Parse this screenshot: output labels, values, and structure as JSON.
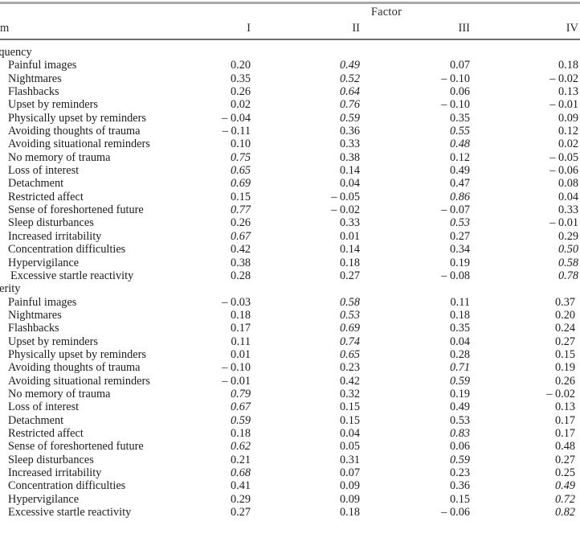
{
  "table": {
    "header": {
      "group_label": "Factor",
      "item_column_label": "m",
      "factor_columns": [
        "I",
        "II",
        "III",
        "IV"
      ]
    },
    "sections": [
      {
        "label": "equency",
        "rows": [
          {
            "item": "Painful images",
            "values": [
              "0.20",
              "0.49",
              "0.07",
              "0.18"
            ],
            "italic": [
              false,
              true,
              false,
              false
            ]
          },
          {
            "item": "Nightmares",
            "values": [
              "0.35",
              "0.52",
              "– 0.10",
              "– 0.02"
            ],
            "italic": [
              false,
              true,
              false,
              false
            ]
          },
          {
            "item": "Flashbacks",
            "values": [
              "0.26",
              "0.64",
              "0.06",
              "0.13"
            ],
            "italic": [
              false,
              true,
              false,
              false
            ]
          },
          {
            "item": "Upset by reminders",
            "values": [
              "0.02",
              "0.76",
              "– 0.10",
              "– 0.01"
            ],
            "italic": [
              false,
              true,
              false,
              false
            ]
          },
          {
            "item": "Physically upset by reminders",
            "values": [
              "– 0.04",
              "0.59",
              "0.35",
              "0.09"
            ],
            "italic": [
              false,
              true,
              false,
              false
            ]
          },
          {
            "item": "Avoiding thoughts of trauma",
            "values": [
              "– 0.11",
              "0.36",
              "0.55",
              "0.12"
            ],
            "italic": [
              false,
              false,
              true,
              false
            ]
          },
          {
            "item": "Avoiding situational reminders",
            "values": [
              "0.10",
              "0.33",
              "0.48",
              "0.02"
            ],
            "italic": [
              false,
              false,
              true,
              false
            ]
          },
          {
            "item": "No memory of trauma",
            "values": [
              "0.75",
              "0.38",
              "0.12",
              "– 0.05"
            ],
            "italic": [
              true,
              false,
              false,
              false
            ]
          },
          {
            "item": "Loss of interest",
            "values": [
              "0.65",
              "0.14",
              "0.49",
              "– 0.06"
            ],
            "italic": [
              true,
              false,
              false,
              false
            ]
          },
          {
            "item": "Detachment",
            "values": [
              "0.69",
              "0.04",
              "0.47",
              "0.08"
            ],
            "italic": [
              true,
              false,
              false,
              false
            ]
          },
          {
            "item": "Restricted affect",
            "values": [
              "0.15",
              "– 0.05",
              "0.86",
              "0.04"
            ],
            "italic": [
              false,
              false,
              true,
              false
            ]
          },
          {
            "item": "Sense of foreshortened future",
            "values": [
              "0.77",
              "– 0.02",
              "– 0.07",
              "0.33"
            ],
            "italic": [
              true,
              false,
              false,
              false
            ]
          },
          {
            "item": "Sleep disturbances",
            "values": [
              "0.26",
              "0.33",
              "0.53",
              "– 0.01"
            ],
            "italic": [
              false,
              false,
              true,
              false
            ]
          },
          {
            "item": "Increased irritability",
            "values": [
              "0.67",
              "0.01",
              "0.27",
              "0.29"
            ],
            "italic": [
              true,
              false,
              false,
              false
            ]
          },
          {
            "item": "Concentration difficulties",
            "values": [
              "0.42",
              "0.14",
              "0.34",
              "0.50"
            ],
            "italic": [
              false,
              false,
              false,
              true
            ]
          },
          {
            "item": "Hypervigilance",
            "values": [
              "0.38",
              "0.18",
              "0.19",
              "0.58"
            ],
            "italic": [
              false,
              false,
              false,
              true
            ]
          },
          {
            "item": "Excessive startle reactivity",
            "values": [
              "0.28",
              "0.27",
              "– 0.08",
              "0.78"
            ],
            "italic": [
              false,
              false,
              false,
              true
            ],
            "extra_indent": true
          }
        ]
      },
      {
        "label": "verity",
        "rows": [
          {
            "item": "Painful images",
            "values": [
              "– 0.03",
              "0.58",
              "0.11",
              "0.37"
            ],
            "italic": [
              false,
              true,
              false,
              false
            ]
          },
          {
            "item": "Nightmares",
            "values": [
              "0.18",
              "0.53",
              "0.18",
              "0.20"
            ],
            "italic": [
              false,
              true,
              false,
              false
            ]
          },
          {
            "item": "Flashbacks",
            "values": [
              "0.17",
              "0.69",
              "0.35",
              "0.24"
            ],
            "italic": [
              false,
              true,
              false,
              false
            ]
          },
          {
            "item": "Upset by reminders",
            "values": [
              "0.11",
              "0.74",
              "0.04",
              "0.27"
            ],
            "italic": [
              false,
              true,
              false,
              false
            ]
          },
          {
            "item": "Physically upset by reminders",
            "values": [
              "0.01",
              "0.65",
              "0.28",
              "0.15"
            ],
            "italic": [
              false,
              true,
              false,
              false
            ]
          },
          {
            "item": "Avoiding thoughts of trauma",
            "values": [
              "– 0.10",
              "0.23",
              "0.71",
              "0.19"
            ],
            "italic": [
              false,
              false,
              true,
              false
            ]
          },
          {
            "item": "Avoiding situational reminders",
            "values": [
              "– 0.01",
              "0.42",
              "0.59",
              "0.26"
            ],
            "italic": [
              false,
              false,
              true,
              false
            ]
          },
          {
            "item": "No memory of trauma",
            "values": [
              "0.79",
              "0.32",
              "0.19",
              "– 0.02"
            ],
            "italic": [
              true,
              false,
              false,
              false
            ]
          },
          {
            "item": "Loss of interest",
            "values": [
              "0.67",
              "0.15",
              "0.49",
              "0.13"
            ],
            "italic": [
              true,
              false,
              false,
              false
            ]
          },
          {
            "item": "Detachment",
            "values": [
              "0.59",
              "0.15",
              "0.53",
              "0.17"
            ],
            "italic": [
              true,
              false,
              false,
              false
            ]
          },
          {
            "item": "Restricted affect",
            "values": [
              "0.18",
              "0.04",
              "0.83",
              "0.17"
            ],
            "italic": [
              false,
              false,
              true,
              false
            ]
          },
          {
            "item": "Sense of foreshortened future",
            "values": [
              "0.62",
              "0.05",
              "0.06",
              "0.48"
            ],
            "italic": [
              true,
              false,
              false,
              false
            ]
          },
          {
            "item": "Sleep disturbances",
            "values": [
              "0.21",
              "0.31",
              "0.59",
              "0.27"
            ],
            "italic": [
              false,
              false,
              true,
              false
            ]
          },
          {
            "item": "Increased irritability",
            "values": [
              "0.68",
              "0.07",
              "0.23",
              "0.25"
            ],
            "italic": [
              true,
              false,
              false,
              false
            ]
          },
          {
            "item": "Concentration difficulties",
            "values": [
              "0.41",
              "0.09",
              "0.36",
              "0.49"
            ],
            "italic": [
              false,
              false,
              false,
              true
            ]
          },
          {
            "item": "Hypervigilance",
            "values": [
              "0.29",
              "0.09",
              "0.15",
              "0.72"
            ],
            "italic": [
              false,
              false,
              false,
              true
            ]
          },
          {
            "item": "Excessive startle reactivity",
            "values": [
              "0.27",
              "0.18",
              "– 0.06",
              "0.82"
            ],
            "italic": [
              false,
              false,
              false,
              true
            ]
          }
        ]
      }
    ]
  }
}
